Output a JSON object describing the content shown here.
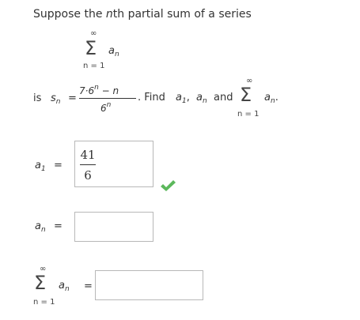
{
  "question": {
    "intro": "Suppose the nth partial sum of a series",
    "intro_pre": "Suppose the ",
    "intro_n": "n",
    "intro_post": "th partial sum of a series",
    "sum_top": "∞",
    "sum_sigma": "Σ",
    "sum_term": "a",
    "sum_term_sub": "n",
    "sum_bottom": "n = 1",
    "is_label": "is",
    "sn_s": "s",
    "sn_sub": "n",
    "equals": "=",
    "formula_num": "7·6",
    "formula_num_exp": "n",
    "formula_num_tail": " − n",
    "formula_den": "6",
    "formula_den_exp": "n",
    "find_text": ". Find",
    "a1_a": "a",
    "a1_sub": "1",
    "comma": ",",
    "an_a": "a",
    "an_sub": "n",
    "and_text": "and",
    "period": "."
  },
  "answers": {
    "a1": {
      "label_a": "a",
      "label_sub": "1",
      "equals": "=",
      "numerator": "41",
      "denominator": "6",
      "status": "correct",
      "check_color": "#5cb85c"
    },
    "an": {
      "label_a": "a",
      "label_sub": "n",
      "equals": "=",
      "value": ""
    },
    "sum": {
      "top": "∞",
      "sigma": "Σ",
      "term": "a",
      "term_sub": "n",
      "bottom": "n = 1",
      "equals": "=",
      "value": ""
    }
  }
}
